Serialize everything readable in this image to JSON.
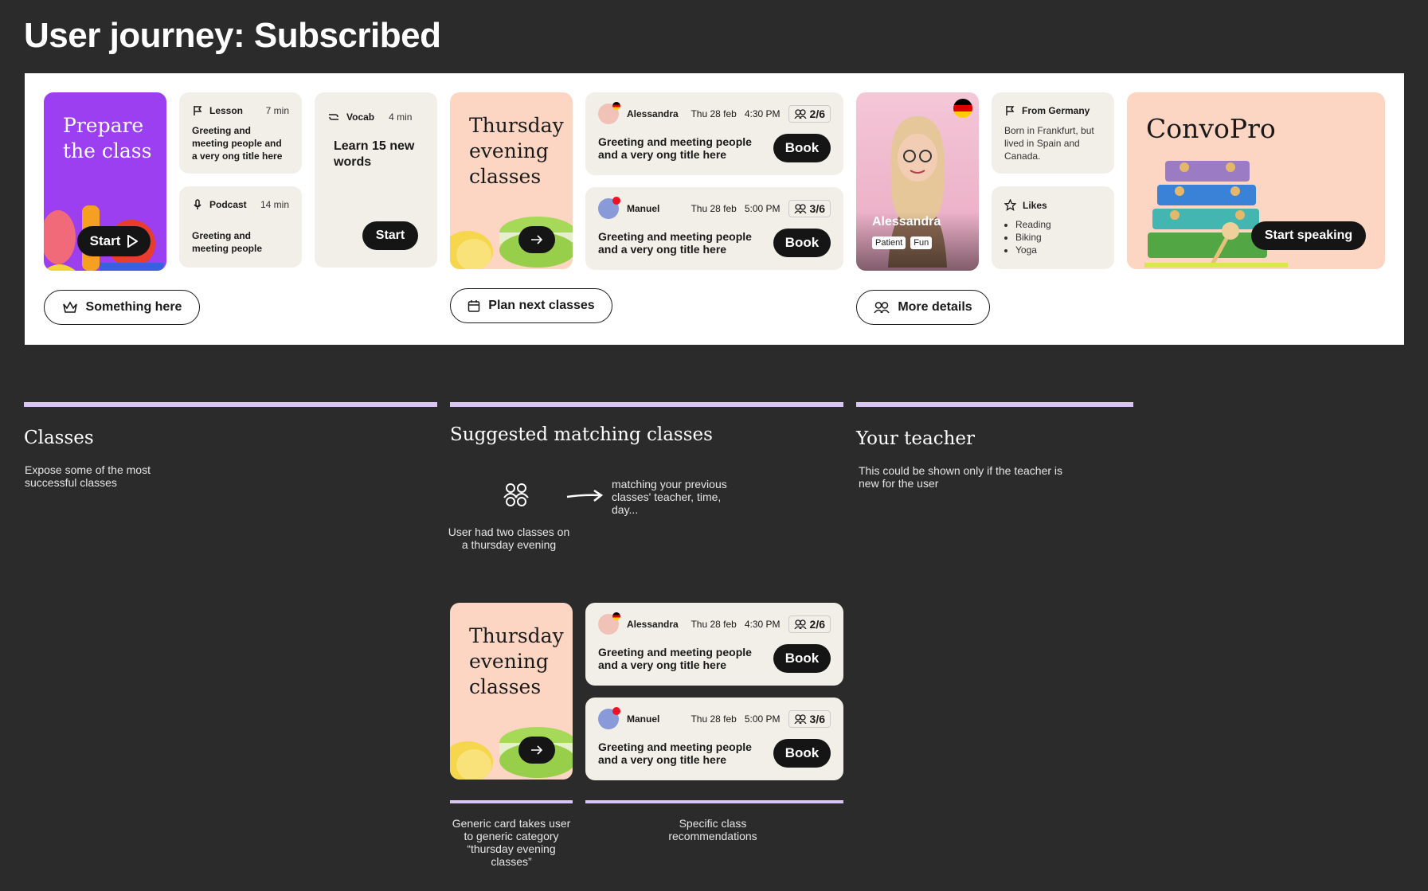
{
  "page": {
    "title": "User journey: Subscribed"
  },
  "colors": {
    "purple": "#9b3ff0",
    "peach": "#fcd5c3",
    "beige": "#f2efe8",
    "accent": "#d9c4f2",
    "dark": "#151515"
  },
  "prepare": {
    "title": "Prepare the class",
    "start": "Start"
  },
  "lesson": {
    "label": "Lesson",
    "duration": "7 min",
    "text": "Greeting and meeting people and a very ong title here"
  },
  "podcast": {
    "label": "Podcast",
    "duration": "14 min",
    "text": "Greeting and meeting people"
  },
  "vocab": {
    "label": "Vocab",
    "duration": "4 min",
    "text": "Learn 15 new words",
    "start": "Start"
  },
  "something_btn": "Something here",
  "thursday": {
    "title": "Thursday evening classes"
  },
  "classes": [
    {
      "teacher": "Alessandra",
      "date": "Thu 28 feb",
      "time": "4:30 PM",
      "count": "2/6",
      "title": "Greeting and meeting people and a very ong title here",
      "book": "Book"
    },
    {
      "teacher": "Manuel",
      "date": "Thu 28 feb",
      "time": "5:00 PM",
      "count": "3/6",
      "title": "Greeting and meeting people and a very ong title here",
      "book": "Book"
    }
  ],
  "plan_btn": "Plan next classes",
  "teacher": {
    "name": "Alessandra",
    "tags": [
      "Patient",
      "Fun"
    ],
    "from_label": "From Germany",
    "from_text": "Born in Frankfurt, but lived in Spain and Canada.",
    "likes_label": "Likes",
    "likes": [
      "Reading",
      "Biking",
      "Yoga"
    ]
  },
  "details_btn": "More details",
  "convopro": {
    "title": "ConvoPro",
    "cta": "Start speaking"
  },
  "sections": {
    "classes": {
      "title": "Classes",
      "desc": "Expose some of the most successful classes"
    },
    "suggested": {
      "title": "Suggested matching classes",
      "left_note": "User had two classes on a thursday evening",
      "right_note": "matching your previous classes' teacher, time, day..."
    },
    "teacher": {
      "title": "Your teacher",
      "desc": "This could be shown only if the teacher is new for the user"
    }
  },
  "captions": {
    "generic": "Generic card takes user to generic category “thursday evening classes”",
    "specific": "Specific class recommendations"
  }
}
